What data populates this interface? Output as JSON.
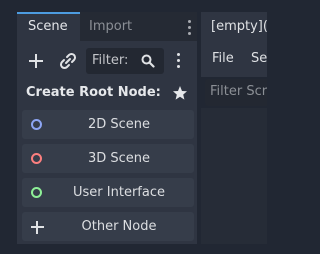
{
  "dock": {
    "tabs": [
      {
        "label": "Scene",
        "active": true
      },
      {
        "label": "Import",
        "active": false
      }
    ],
    "toolbar": {
      "filter_label": "Filter:",
      "add_icon": "plus-icon",
      "link_icon": "link-icon",
      "search_icon": "search-icon",
      "menu_icon": "vertical-ellipsis-icon"
    },
    "create_root_title": "Create Root Node:",
    "favorite_icon": "star-icon",
    "root_nodes": [
      {
        "label": "2D Scene",
        "icon": "circle-icon",
        "color": "#8da5f3"
      },
      {
        "label": "3D Scene",
        "icon": "circle-icon",
        "color": "#fc7f7f"
      },
      {
        "label": "User Interface",
        "icon": "circle-icon",
        "color": "#8eef97"
      },
      {
        "label": "Other Node",
        "icon": "plus-icon",
        "color": "#e0e2e5"
      }
    ]
  },
  "editor": {
    "tab_label": "[empty](",
    "menu": [
      "File",
      "Se"
    ],
    "filter_placeholder": "Filter Scr"
  },
  "colors": {
    "background": "#212733",
    "panel": "#2f3542",
    "button": "#363d4a",
    "accent": "#4d9ce0"
  }
}
